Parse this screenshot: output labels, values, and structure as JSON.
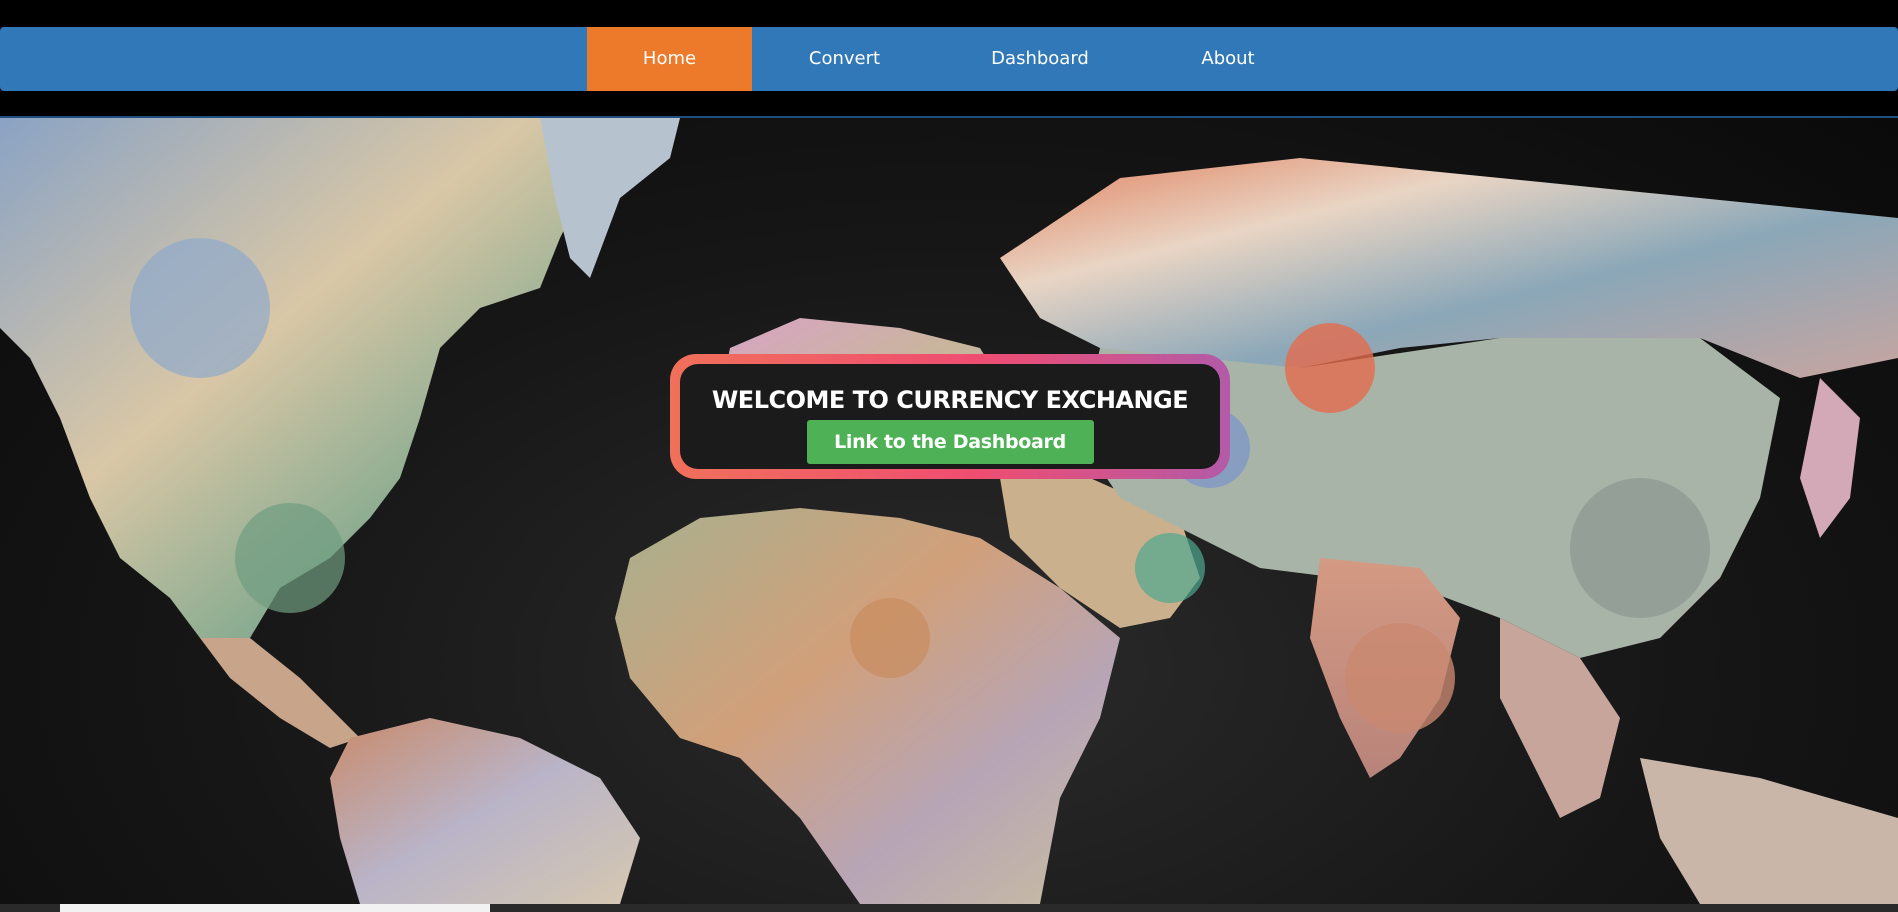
{
  "nav": {
    "items": [
      {
        "label": "Home",
        "active": true
      },
      {
        "label": "Convert",
        "active": false
      },
      {
        "label": "Dashboard",
        "active": false
      },
      {
        "label": "About",
        "active": false
      }
    ]
  },
  "hero": {
    "title": "WELCOME TO CURRENCY EXCHANGE",
    "button_label": "Link to the Dashboard",
    "background_image": "world-map-made-of-banknotes"
  },
  "colors": {
    "nav_bg": "#3078b8",
    "nav_active": "#ec7a2a",
    "button_bg": "#4fb155",
    "card_gradient": [
      "#f0705a",
      "#ef4d71",
      "#b35aa8"
    ]
  }
}
